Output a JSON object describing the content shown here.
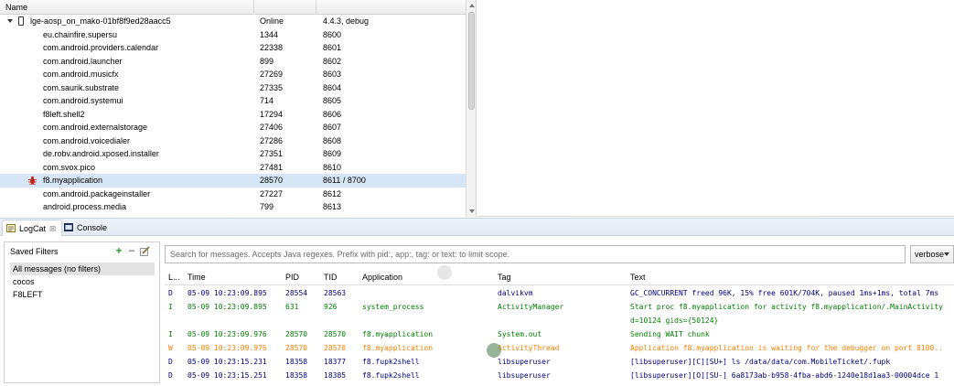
{
  "devices": {
    "header": {
      "name": "Name"
    },
    "device_row": {
      "name": "lge-aosp_on_mako-01bf8f9ed28aacc5",
      "status": "Online",
      "info": "4.4.3, debug"
    },
    "rows": [
      {
        "name": "eu.chainfire.supersu",
        "pid": "1344",
        "port": "8600"
      },
      {
        "name": "com.android.providers.calendar",
        "pid": "22338",
        "port": "8601"
      },
      {
        "name": "com.android.launcher",
        "pid": "899",
        "port": "8602"
      },
      {
        "name": "com.android.musicfx",
        "pid": "27269",
        "port": "8603"
      },
      {
        "name": "com.saurik.substrate",
        "pid": "27335",
        "port": "8604"
      },
      {
        "name": "com.android.systemui",
        "pid": "714",
        "port": "8605"
      },
      {
        "name": "f8left.shell2",
        "pid": "17294",
        "port": "8606"
      },
      {
        "name": "com.android.externalstorage",
        "pid": "27406",
        "port": "8607"
      },
      {
        "name": "com.android.voicedialer",
        "pid": "27286",
        "port": "8608"
      },
      {
        "name": "de.robv.android.xposed.installer",
        "pid": "27351",
        "port": "8609"
      },
      {
        "name": "com.svox.pico",
        "pid": "27481",
        "port": "8610"
      },
      {
        "name": "f8.myapplication",
        "pid": "28570",
        "port": "8611 / 8700",
        "selected": true
      },
      {
        "name": "com.android.packageinstaller",
        "pid": "27227",
        "port": "8612"
      },
      {
        "name": "android.process.media",
        "pid": "799",
        "port": "8613"
      }
    ]
  },
  "tabs": [
    {
      "label": "LogCat",
      "icon": "logcat-icon",
      "close": "☒"
    },
    {
      "label": "Console",
      "icon": "console-icon"
    }
  ],
  "saved_filters": {
    "title": "Saved Filters",
    "buttons": {
      "add": "+",
      "remove": "−"
    },
    "items": [
      "All messages (no filters)",
      "cocos",
      "F8LEFT"
    ]
  },
  "search": {
    "placeholder": "Search for messages. Accepts Java regexes. Prefix with pid:, app:, tag: or text: to limit scope."
  },
  "level_select": {
    "value": "verbose"
  },
  "log": {
    "headers": [
      "L...",
      "Time",
      "PID",
      "TID",
      "Application",
      "Tag",
      "Text"
    ],
    "rows": [
      {
        "level": "D",
        "time": "05-09 10:23:09.895",
        "pid": "28554",
        "tid": "28563",
        "app": "",
        "tag": "dalvikvm",
        "text": "GC_CONCURRENT freed 96K, 15% free 601K/704K, paused 1ms+1ms, total 7ms"
      },
      {
        "level": "I",
        "time": "05-09 10:23:09.895",
        "pid": "631",
        "tid": "926",
        "app": "system_process",
        "tag": "ActivityManager",
        "text": "Start proc f8.myapplication for activity f8.myapplication/.MainActivity"
      },
      {
        "level": "I",
        "time": "",
        "pid": "",
        "tid": "",
        "app": "",
        "tag": "",
        "text": "d=10124 gids={50124}"
      },
      {
        "level": "I",
        "time": "05-09 10:23:09.976",
        "pid": "28570",
        "tid": "28570",
        "app": "f8.myapplication",
        "tag": "System.out",
        "text": "Sending WAIT chunk"
      },
      {
        "level": "W",
        "time": "05-09 10:23:09.976",
        "pid": "28570",
        "tid": "28570",
        "app": "f8.myapplication",
        "tag": "ActivityThread",
        "text": "Application f8.myapplication is waiting for the debugger on port 8100.."
      },
      {
        "level": "D",
        "time": "05-09 10:23:15.231",
        "pid": "18358",
        "tid": "18377",
        "app": "f8.fupk2shell",
        "tag": "libsuperuser",
        "text": "[libsuperuser][C][SU+] ls /data/data/com.MobileTicket/.fupk"
      },
      {
        "level": "D",
        "time": "05-09 10:23:15.251",
        "pid": "18358",
        "tid": "18385",
        "app": "f8.fupk2shell",
        "tag": "libsuperuser",
        "text": "[libsuperuser][O][SU-] 6a8173ab-b958-4fba-abd6-1240e18d1aa3-00004dce 1"
      }
    ]
  }
}
